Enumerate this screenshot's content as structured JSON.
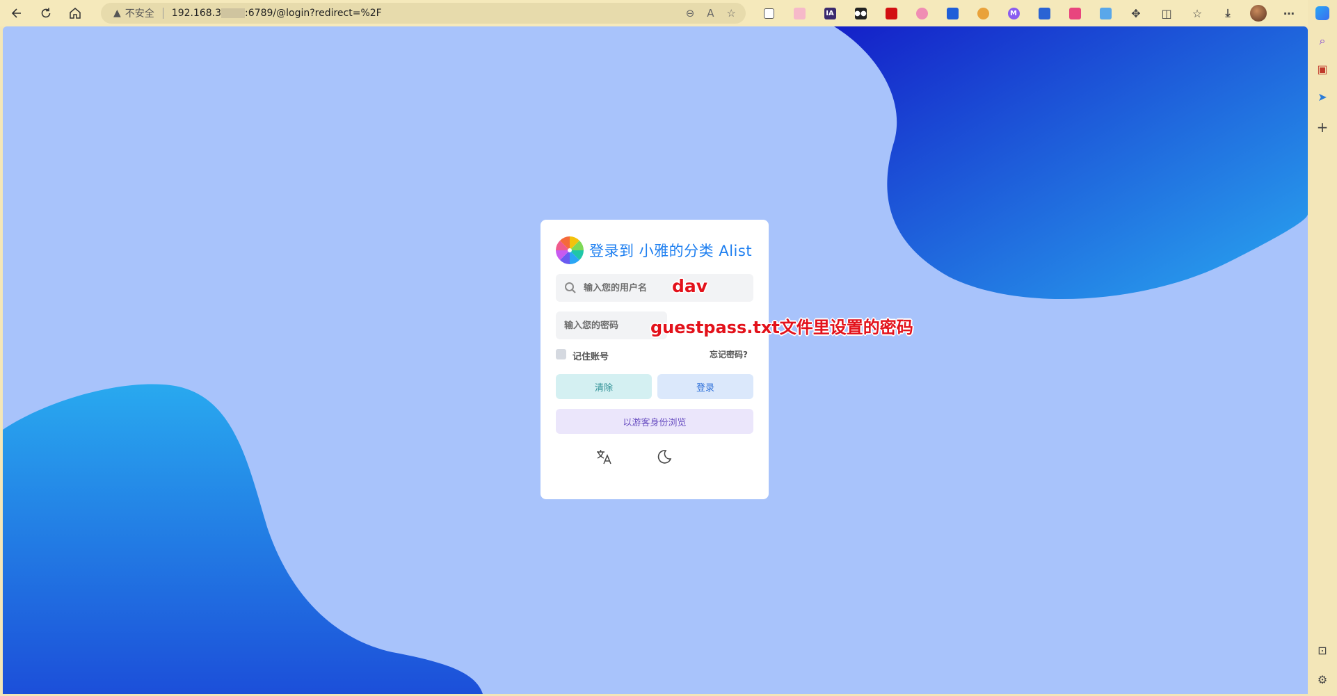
{
  "browser": {
    "security_text": "不安全",
    "url_prefix": "192.168.3",
    "url_suffix": ":6789/@login?redirect=%2F"
  },
  "login": {
    "title": "登录到 小雅的分类 Alist",
    "username_placeholder": "输入您的用户名",
    "password_placeholder": "输入您的密码",
    "remember_label": "记住账号",
    "forgot_label": "忘记密码?",
    "clear_label": "清除",
    "login_label": "登录",
    "guest_label": "以游客身份浏览"
  },
  "annotations": {
    "username_note": "dav",
    "password_note": "guestpass.txt文件里设置的密码"
  },
  "colors": {
    "background": "#a8c3fb",
    "accent": "#1e7ff0",
    "annotation": "#e3121b"
  }
}
